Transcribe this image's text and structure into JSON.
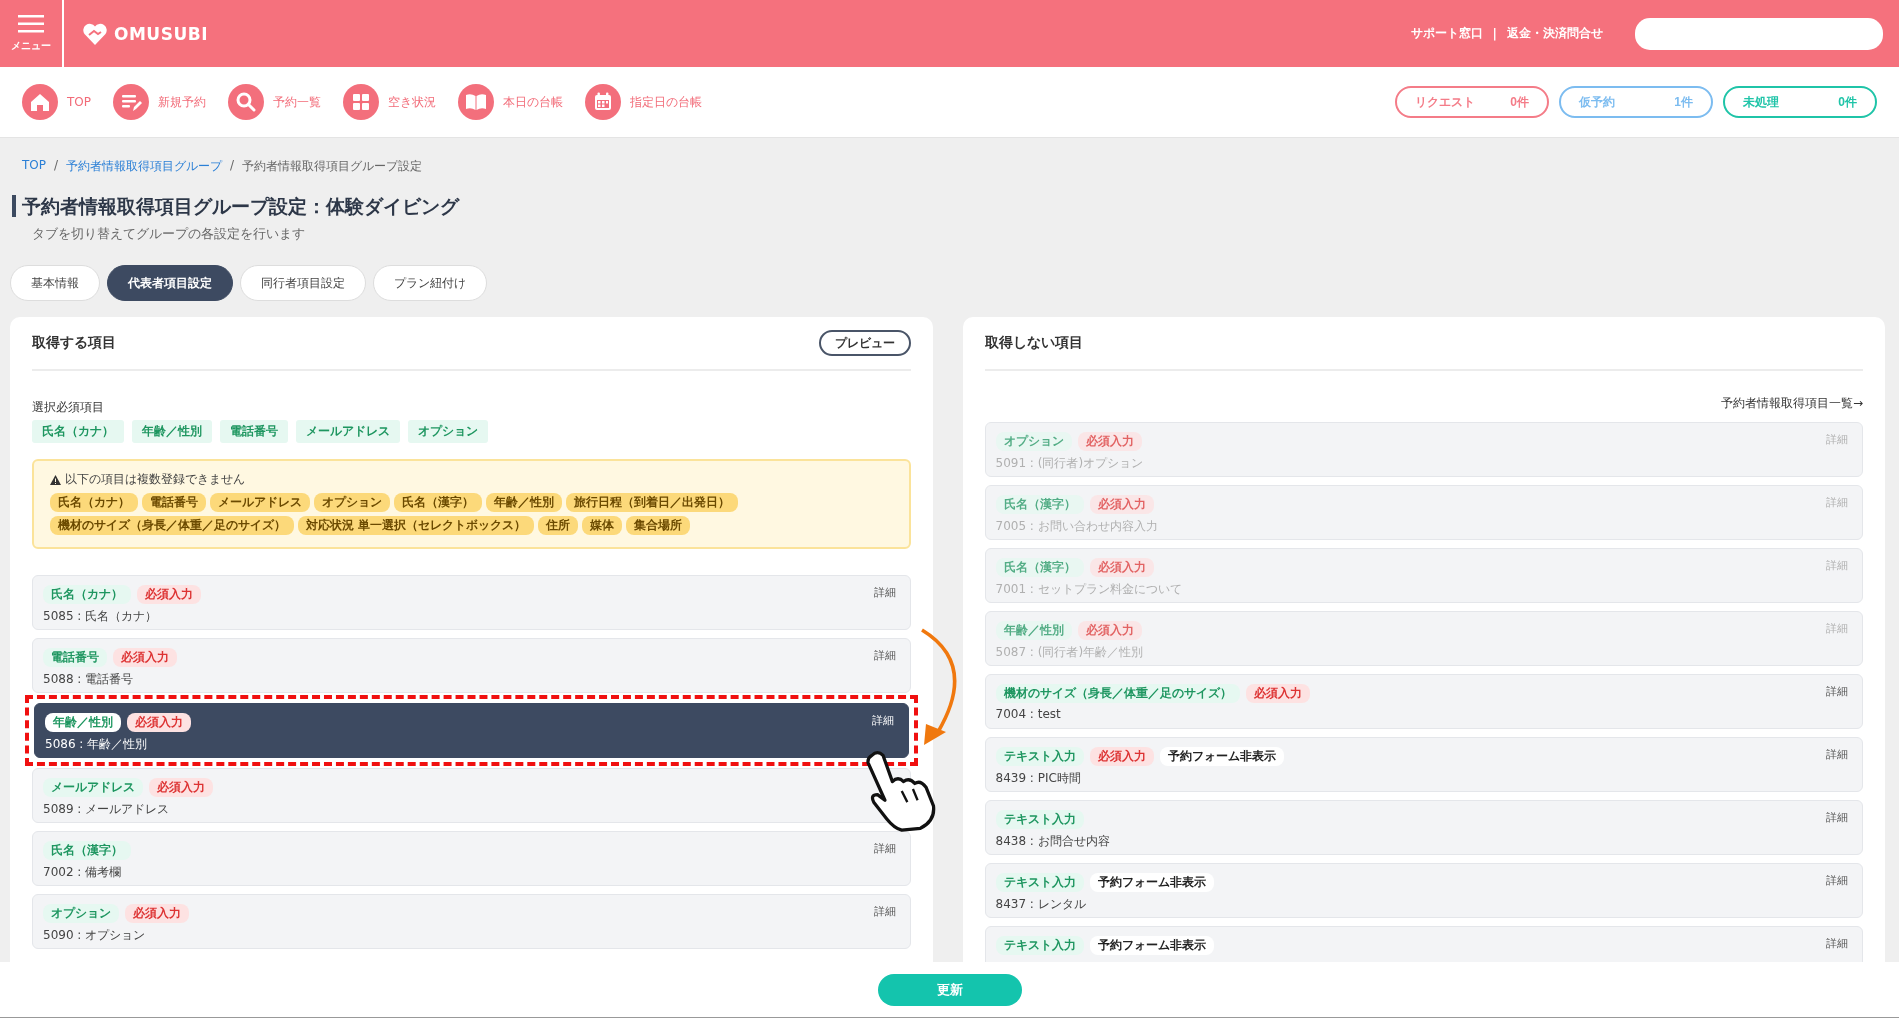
{
  "header": {
    "menu_label": "メニュー",
    "logo": "OMUSUBI",
    "links": [
      "サポート窓口",
      "返金・決済問合せ"
    ],
    "separator": "|"
  },
  "nav": [
    {
      "label": "TOP",
      "kind": "home"
    },
    {
      "label": "新規予約",
      "kind": "edit"
    },
    {
      "label": "予約一覧",
      "kind": "search"
    },
    {
      "label": "空き状況",
      "kind": "grid"
    },
    {
      "label": "本日の台帳",
      "kind": "book"
    },
    {
      "label": "指定日の台帳",
      "kind": "calendar"
    }
  ],
  "status_pills": [
    {
      "label": "リクエスト",
      "count": "0件",
      "color": "#f47c88"
    },
    {
      "label": "仮予約",
      "count": "1件",
      "color": "#7cbcf0"
    },
    {
      "label": "未処理",
      "count": "0件",
      "color": "#1fc4a8"
    }
  ],
  "breadcrumb": {
    "separator": "/",
    "items": [
      {
        "label": "TOP",
        "link": true
      },
      {
        "label": "予約者情報取得項目グループ",
        "link": true
      },
      {
        "label": "予約者情報取得項目グループ設定",
        "link": false
      }
    ]
  },
  "title": "予約者情報取得項目グループ設定：体験ダイビング",
  "subtitle": "タブを切り替えてグループの各設定を行います",
  "tabs": [
    {
      "label": "基本情報",
      "selected": false
    },
    {
      "label": "代表者項目設定",
      "selected": true
    },
    {
      "label": "同行者項目設定",
      "selected": false
    },
    {
      "label": "プラン紐付け",
      "selected": false
    }
  ],
  "left_panel": {
    "heading": "取得する項目",
    "preview_button": "プレビュー",
    "required_label": "選択必須項目",
    "required_chips": [
      "氏名（カナ）",
      "年齢／性別",
      "電話番号",
      "メールアドレス",
      "オプション"
    ],
    "notice": {
      "text": "以下の項目は複数登録できません",
      "chips": [
        "氏名（カナ）",
        "電話番号",
        "メールアドレス",
        "オプション",
        "氏名（漢字）",
        "年齢／性別",
        "旅行日程（到着日／出発日）",
        "機材のサイズ（身長／体重／足のサイズ）",
        "対応状況 単一選択（セレクトボックス）",
        "住所",
        "媒体",
        "集合場所"
      ]
    },
    "items": [
      {
        "tags": [
          {
            "kind": "type",
            "label": "氏名（カナ）"
          },
          {
            "kind": "required",
            "label": "必須入力"
          }
        ],
        "label": "5085 : 氏名（カナ）",
        "detail": "詳細",
        "selected": false
      },
      {
        "tags": [
          {
            "kind": "type",
            "label": "電話番号"
          },
          {
            "kind": "required",
            "label": "必須入力"
          }
        ],
        "label": "5088 : 電話番号",
        "detail": "詳細",
        "selected": false
      },
      {
        "tags": [
          {
            "kind": "type",
            "label": "年齢／性別"
          },
          {
            "kind": "required",
            "label": "必須入力"
          }
        ],
        "label": "5086 : 年齢／性別",
        "detail": "詳細",
        "selected": true
      },
      {
        "tags": [
          {
            "kind": "type",
            "label": "メールアドレス"
          },
          {
            "kind": "required",
            "label": "必須入力"
          }
        ],
        "label": "5089 : メールアドレス",
        "selected": false
      },
      {
        "tags": [
          {
            "kind": "type",
            "label": "氏名（漢字）"
          }
        ],
        "label": "7002 : 備考欄",
        "detail": "詳細",
        "selected": false
      },
      {
        "tags": [
          {
            "kind": "type",
            "label": "オプション"
          },
          {
            "kind": "required",
            "label": "必須入力"
          }
        ],
        "label": "5090 : オプション",
        "detail": "詳細",
        "selected": false
      }
    ]
  },
  "right_panel": {
    "heading": "取得しない項目",
    "list_link": "予約者情報取得項目一覧→",
    "items": [
      {
        "tags": [
          {
            "kind": "type",
            "label": "オプション"
          },
          {
            "kind": "required",
            "label": "必須入力"
          }
        ],
        "label": "5091 : (同行者)オプション",
        "detail": "詳細",
        "disabled": true
      },
      {
        "tags": [
          {
            "kind": "type",
            "label": "氏名（漢字）"
          },
          {
            "kind": "required",
            "label": "必須入力"
          }
        ],
        "label": "7005 : お問い合わせ内容入力",
        "detail": "詳細",
        "disabled": true
      },
      {
        "tags": [
          {
            "kind": "type",
            "label": "氏名（漢字）"
          },
          {
            "kind": "required",
            "label": "必須入力"
          }
        ],
        "label": "7001 : セットプラン料金について",
        "detail": "詳細",
        "disabled": true
      },
      {
        "tags": [
          {
            "kind": "type",
            "label": "年齢／性別"
          },
          {
            "kind": "required",
            "label": "必須入力"
          }
        ],
        "label": "5087 : (同行者)年齢／性別",
        "detail": "詳細",
        "disabled": true
      },
      {
        "tags": [
          {
            "kind": "type",
            "label": "機材のサイズ（身長／体重／足のサイズ）"
          },
          {
            "kind": "required",
            "label": "必須入力"
          }
        ],
        "label": "7004 : test",
        "detail": "詳細",
        "disabled": false
      },
      {
        "tags": [
          {
            "kind": "type",
            "label": "テキスト入力"
          },
          {
            "kind": "required",
            "label": "必須入力"
          },
          {
            "kind": "hidden",
            "label": "予約フォーム非表示"
          }
        ],
        "label": "8439 : PIC時間",
        "detail": "詳細",
        "disabled": false
      },
      {
        "tags": [
          {
            "kind": "type",
            "label": "テキスト入力"
          }
        ],
        "label": "8438 : お問合せ内容",
        "detail": "詳細",
        "disabled": false
      },
      {
        "tags": [
          {
            "kind": "type",
            "label": "テキスト入力"
          },
          {
            "kind": "hidden",
            "label": "予約フォーム非表示"
          }
        ],
        "label": "8437 : レンタル",
        "detail": "詳細",
        "disabled": false
      },
      {
        "tags": [
          {
            "kind": "type",
            "label": "テキスト入力"
          },
          {
            "kind": "hidden",
            "label": "予約フォーム非表示"
          }
        ],
        "detail": "詳細",
        "disabled": false
      }
    ]
  },
  "footer": {
    "update_button": "更新"
  }
}
